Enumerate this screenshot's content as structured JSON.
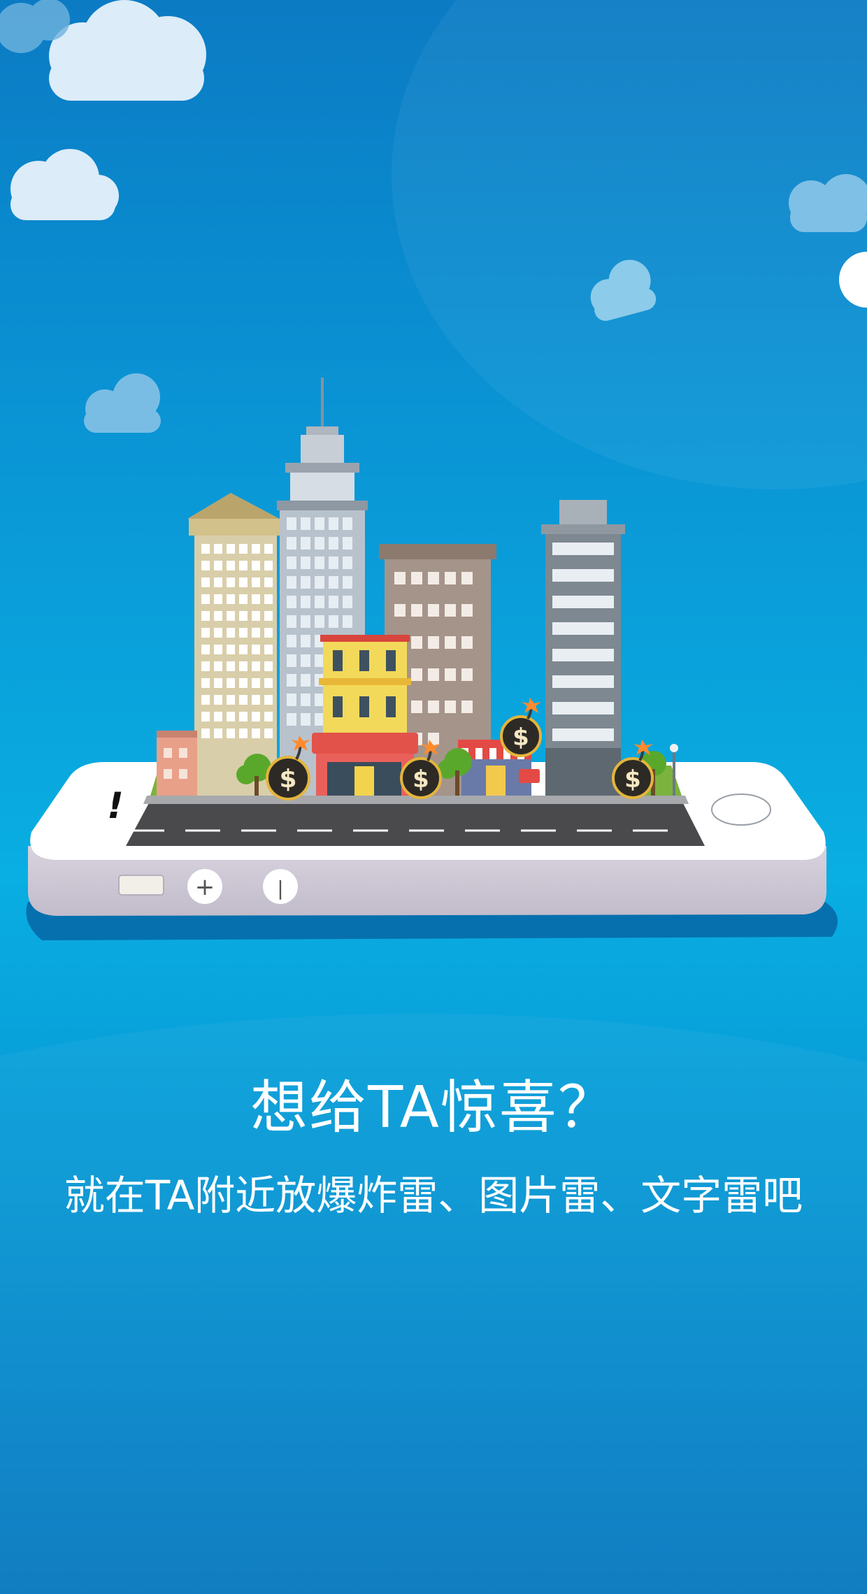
{
  "intro": {
    "headline": "想给TA惊喜？",
    "subline": "就在TA附近放爆炸雷、图片雷、文字雷吧"
  },
  "illustration": {
    "bomb_symbol": "$",
    "phone_glyphs": {
      "alert": "!",
      "plus": "+",
      "power": "|"
    }
  },
  "colors": {
    "background_top": "#0b7bc4",
    "background_mid": "#09aee2",
    "background_bottom": "#0878bf",
    "text": "#ffffff"
  }
}
